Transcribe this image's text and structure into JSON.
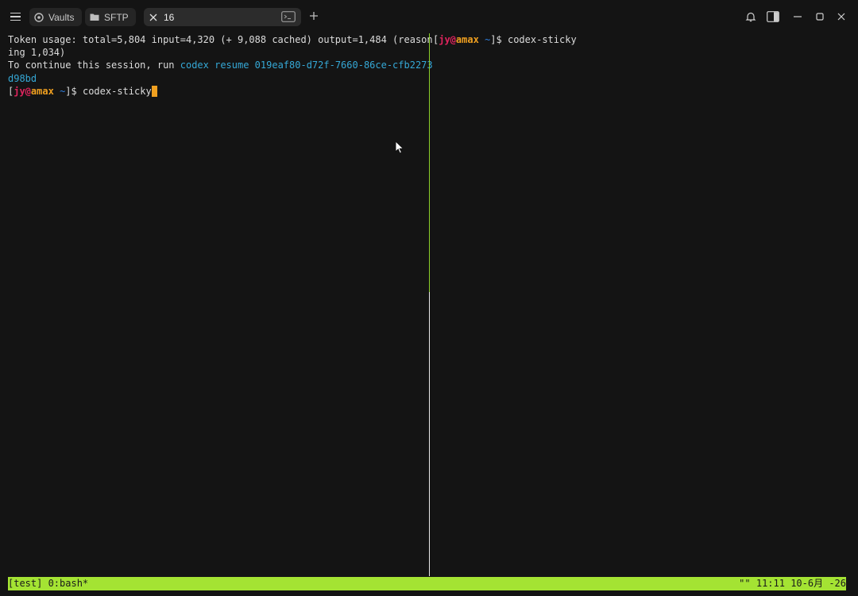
{
  "tabs": {
    "vaults_label": "Vaults",
    "sftp_label": "SFTP",
    "active_label": "16"
  },
  "left_pane": {
    "line1": "Token usage: total=5,804 input=4,320 (+ 9,088 cached) output=1,484 (reason",
    "line2": "ing 1,034)",
    "line3_prefix": "To continue this session, run ",
    "line3_cmd": "codex resume 019eaf80-d72f-7660-86ce-cfb2273",
    "line4": "d98bd",
    "prompt_user": "jy@amax",
    "prompt_dir": "~",
    "command": "codex-sticky"
  },
  "right_pane": {
    "prompt_user": "jy@amax",
    "prompt_dir": "~",
    "command": "codex-sticky"
  },
  "status_bar": {
    "left": "[test] 0:bash*",
    "right": "\"\" 11:11 10-6月 -26"
  },
  "colors": {
    "status_bg": "#a4e333",
    "active_divider": "#8ccf2a",
    "prompt_user": "#e0245e",
    "prompt_host": "#f0a020",
    "link": "#35a8d6",
    "dir": "#2f7fe0"
  },
  "icons": [
    "menu-icon",
    "vault-icon",
    "folder-icon",
    "close-icon",
    "terminal-icon",
    "plus-icon",
    "bell-icon",
    "sidebar-toggle-icon",
    "minimize-icon",
    "maximize-icon",
    "window-close-icon",
    "mouse-pointer-icon"
  ]
}
